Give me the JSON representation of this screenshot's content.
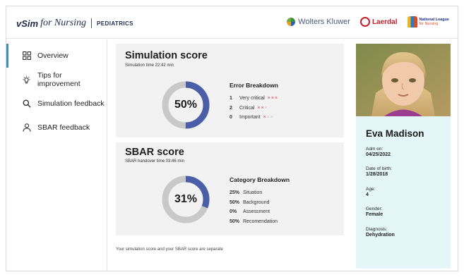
{
  "header": {
    "brand_v": "vSim",
    "brand_for": "for Nursing",
    "brand_sub": "PEDIATRICS",
    "logo_wk": "Wolters Kluwer",
    "logo_laerdal": "Laerdal",
    "logo_nln_line1": "National League",
    "logo_nln_line2": "for Nursing"
  },
  "sidebar": {
    "items": [
      {
        "label": "Overview",
        "icon": "grid-icon",
        "active": true
      },
      {
        "label": "Tips for improvement",
        "icon": "lightbulb-icon",
        "active": false
      },
      {
        "label": "Simulation feedback",
        "icon": "search-icon",
        "active": false
      },
      {
        "label": "SBAR feedback",
        "icon": "person-icon",
        "active": false
      }
    ]
  },
  "simulation": {
    "title": "Simulation score",
    "time": "Simulation time 22:42 min",
    "percent_label": "50%",
    "percent": 50,
    "breakdown_title": "Error Breakdown",
    "rows": [
      {
        "count": "1",
        "label": "Very critical",
        "marks_on": 3,
        "marks_total": 3
      },
      {
        "count": "2",
        "label": "Critical",
        "marks_on": 2,
        "marks_total": 3
      },
      {
        "count": "0",
        "label": "Important",
        "marks_on": 1,
        "marks_total": 3
      }
    ]
  },
  "sbar": {
    "title": "SBAR score",
    "time": "SBAR handover time 03:46 min",
    "percent_label": "31%",
    "percent": 31,
    "breakdown_title": "Category Breakdown",
    "rows": [
      {
        "pct": "25%",
        "label": "Situation"
      },
      {
        "pct": "50%",
        "label": "Background"
      },
      {
        "pct": "0%",
        "label": "Assessment"
      },
      {
        "pct": "50%",
        "label": "Recomendation"
      }
    ]
  },
  "note": "Your simulation score and your SBAR score are separate",
  "patient": {
    "name": "Eva Madison",
    "adm_label": "Adm on:",
    "adm_value": "04/25/2022",
    "dob_label": "Date of birth:",
    "dob_value": "1/28/2018",
    "age_label": "Age:",
    "age_value": "4",
    "gender_label": "Gender:",
    "gender_value": "Female",
    "diagnosis_label": "Diagnosis:",
    "diagnosis_value": "Dehydration"
  },
  "colors": {
    "accent": "#3f8fb6",
    "donut_fill": "#4a5fa8",
    "donut_track": "#c9c9c9",
    "error_mark": "#d9303a",
    "patient_bg": "#e4f6f8"
  }
}
